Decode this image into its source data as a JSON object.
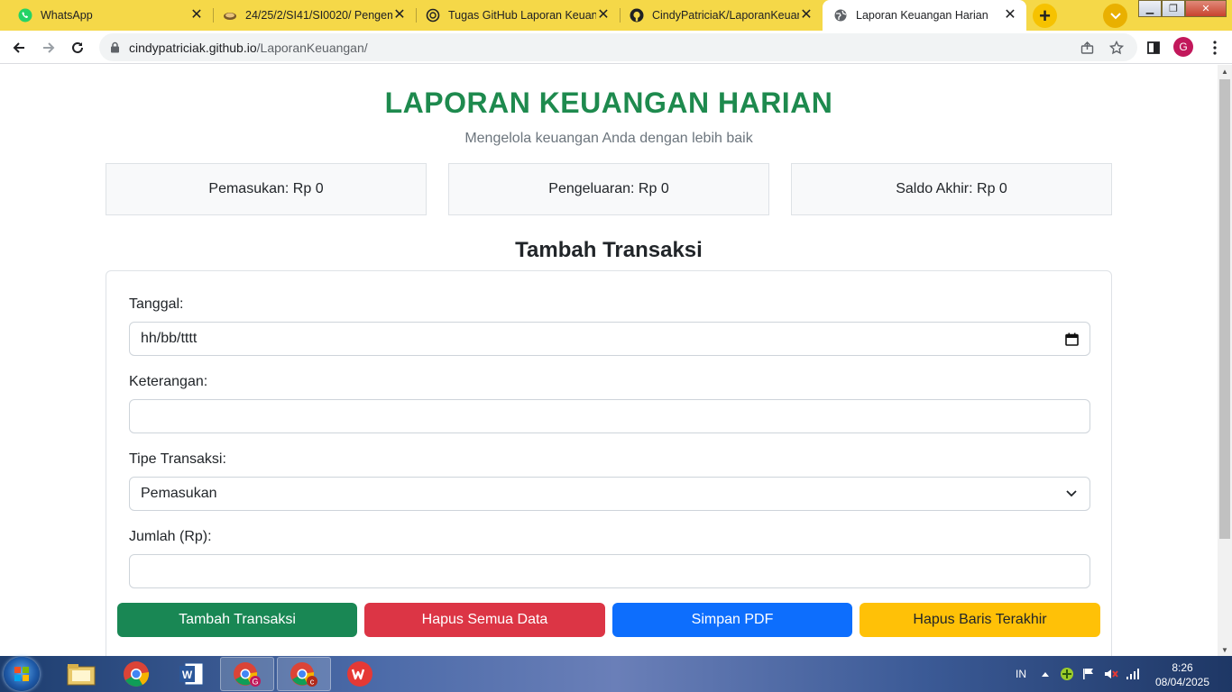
{
  "browser": {
    "tabs": [
      {
        "title": "WhatsApp",
        "icon": "whatsapp-icon",
        "active": false
      },
      {
        "title": "24/25/2/SI41/SI0020/ Pengem",
        "icon": "course-icon",
        "active": false
      },
      {
        "title": "Tugas GitHub Laporan Keuang",
        "icon": "chatgpt-icon",
        "active": false
      },
      {
        "title": "CindyPatriciaK/LaporanKeuang",
        "icon": "github-icon",
        "active": false
      },
      {
        "title": "Laporan Keuangan Harian",
        "icon": "globe-icon",
        "active": true
      }
    ],
    "url_host": "cindypatriciak.github.io",
    "url_path": "/LaporanKeuangan/",
    "profile_initial": "G"
  },
  "page": {
    "title": "LAPORAN KEUANGAN HARIAN",
    "subtitle": "Mengelola keuangan Anda dengan lebih baik",
    "summary": {
      "income": "Pemasukan: Rp 0",
      "expense": "Pengeluaran: Rp 0",
      "balance": "Saldo Akhir: Rp 0"
    },
    "form": {
      "heading": "Tambah Transaksi",
      "date_label": "Tanggal:",
      "date_placeholder": "hh/bb/tttt",
      "desc_label": "Keterangan:",
      "desc_value": "",
      "type_label": "Tipe Transaksi:",
      "type_value": "Pemasukan",
      "amount_label": "Jumlah (Rp):",
      "amount_value": ""
    },
    "buttons": {
      "add": "Tambah Transaksi",
      "clear_all": "Hapus Semua Data",
      "save_pdf": "Simpan PDF",
      "delete_last": "Hapus Baris Terakhir"
    },
    "colors": {
      "title_green": "#1e8a4e",
      "btn_green": "#198754",
      "btn_red": "#dc3545",
      "btn_blue": "#0d6efd",
      "btn_yellow": "#ffc107"
    }
  },
  "taskbar": {
    "language": "IN",
    "time": "8:26",
    "date": "08/04/2025",
    "apps": [
      "file-explorer-icon",
      "chrome-icon",
      "word-icon",
      "chrome-profile-g-icon",
      "chrome-profile-c-icon",
      "wps-icon"
    ]
  }
}
